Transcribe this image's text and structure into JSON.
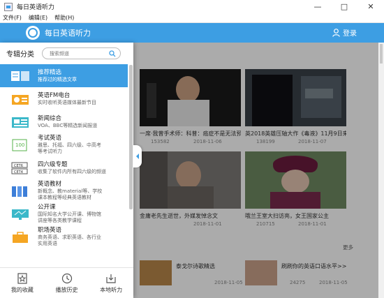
{
  "window": {
    "title": "每日英语听力",
    "minimize": "—",
    "maximize": "□",
    "close": "✕"
  },
  "menu": [
    "文件(F)",
    "编辑(E)",
    "帮助(H)"
  ],
  "header": {
    "brand": "每日英语听力",
    "login": "登录",
    "accent": "#3d9ee3"
  },
  "sidebar": {
    "title": "专辑分类",
    "search_placeholder": "搜索频道",
    "categories": [
      {
        "name": "推荐精选",
        "desc": "推荐过的精选文章",
        "icon": "featured-icon",
        "active": true
      },
      {
        "name": "英语FM电台",
        "desc": "实时收听英语媒体最新节目",
        "icon": "radio-icon"
      },
      {
        "name": "新闻综合",
        "desc": "VOA、BBC等精选新闻报道",
        "icon": "news-icon"
      },
      {
        "name": "考试英语",
        "desc": "雅思、托福、四六级、中高考等考试听力",
        "icon": "exam-icon"
      },
      {
        "name": "四六级专题",
        "desc": "收集了软件内所有四六级的频道",
        "icon": "cet-icon"
      },
      {
        "name": "英语教材",
        "desc": "新概念、教material等、学校课本教程等经典英语教材",
        "icon": "textbook-icon"
      },
      {
        "name": "公开课",
        "desc": "国际知名大学公开课、博物馆讲座等各类教学课程",
        "icon": "lecture-icon"
      },
      {
        "name": "职场英语",
        "desc": "商务英语、求职英语、各行业实用英语",
        "icon": "career-icon"
      }
    ],
    "bottom": [
      "我的收藏",
      "播放历史",
      "本地听力"
    ]
  },
  "main": {
    "cards": [
      {
        "title": "一席·我曾手术师：科普：癌症不是无法预防",
        "plays": "153582",
        "date": "2018-11-06"
      },
      {
        "title": "英2018英雄压轴大作《毒液》11月9日来",
        "plays": "138199",
        "date": "2018-11-07"
      },
      {
        "title": "金庸老先生逝世，外媒发悼念文",
        "plays": "",
        "date": "2018-11-01"
      },
      {
        "title": "哦兰王室大扫访亮，女王国家公主",
        "plays": "210715",
        "date": "2018-11-01"
      }
    ],
    "more": "更多",
    "rows": [
      {
        "title": "泰戈尔诗歌精选",
        "plays": "",
        "date": "2018-11-05"
      },
      {
        "title": "刷刷你的英语口语水平>>",
        "plays": "24275",
        "date": "2018-11-05"
      }
    ]
  }
}
